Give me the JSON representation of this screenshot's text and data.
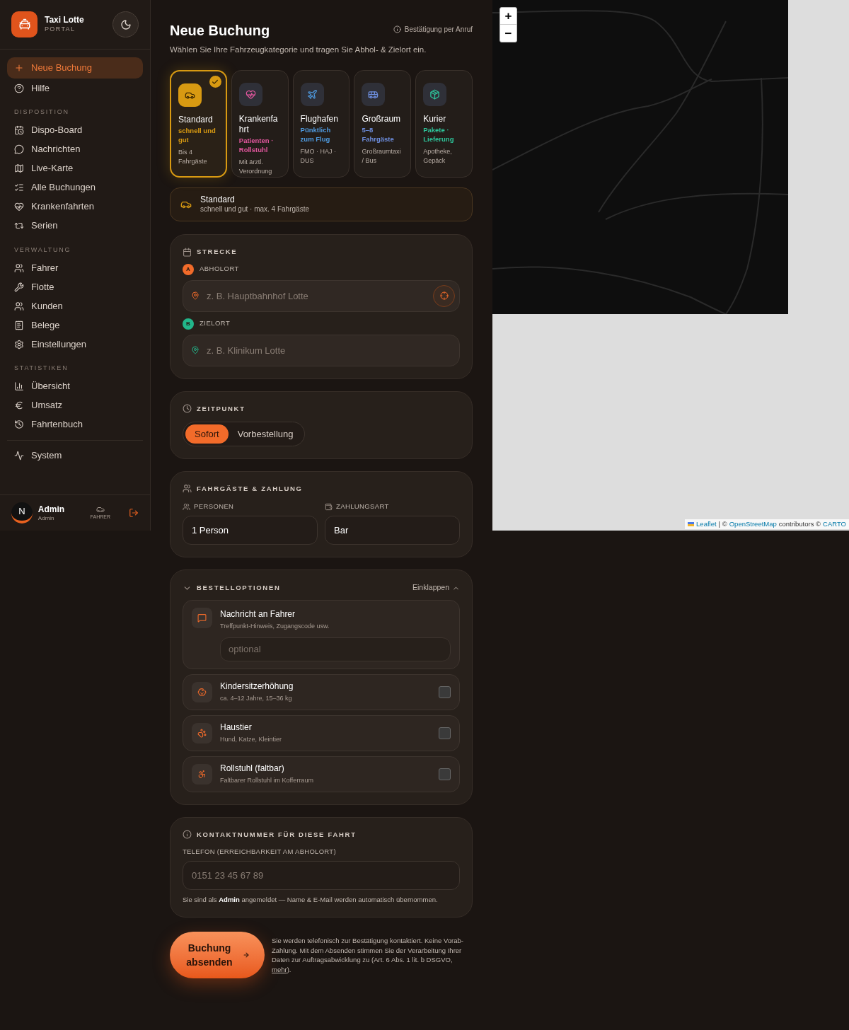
{
  "sidebar": {
    "brand": {
      "title": "Taxi Lotte",
      "subtitle": "PORTAL"
    },
    "top_items": [
      {
        "label": "Neue Buchung",
        "selected": true
      },
      {
        "label": "Hilfe",
        "selected": false
      }
    ],
    "sections": [
      {
        "title": "DISPOSITION",
        "items": [
          {
            "label": "Dispo-Board",
            "selected": false
          },
          {
            "label": "Nachrichten",
            "selected": false
          },
          {
            "label": "Live-Karte",
            "selected": false
          },
          {
            "label": "Alle Buchungen",
            "selected": false
          },
          {
            "label": "Krankenfahrten",
            "selected": false
          },
          {
            "label": "Serien",
            "selected": false
          }
        ]
      },
      {
        "title": "VERWALTUNG",
        "items": [
          {
            "label": "Fahrer",
            "selected": false
          },
          {
            "label": "Flotte",
            "selected": false
          },
          {
            "label": "Kunden",
            "selected": false
          },
          {
            "label": "Belege",
            "selected": false
          },
          {
            "label": "Einstellungen",
            "selected": false
          }
        ]
      },
      {
        "title": "STATISTIKEN",
        "items": [
          {
            "label": "Übersicht",
            "selected": false
          },
          {
            "label": "Umsatz",
            "selected": false
          },
          {
            "label": "Fahrtenbuch",
            "selected": false
          }
        ]
      }
    ],
    "bottom_items": [
      {
        "label": "System",
        "selected": false
      }
    ],
    "user": {
      "initial": "N",
      "name": "Admin",
      "role": "Admin",
      "switch_label": "FAHRER"
    }
  },
  "header": {
    "title": "Neue Buchung",
    "subtitle": "Wählen Sie Ihre Fahrzeugkategorie und tragen Sie Abhol- & Zielort ein.",
    "info": "Bestätigung per Anruf"
  },
  "vehicles": [
    {
      "title": "Standard",
      "tagline": "schnell und gut",
      "detail": "Bis 4 Fahrgäste",
      "color": "#d89a12",
      "selected": true
    },
    {
      "title": "Krankenfahrt",
      "tagline": "Patienten · Rollstuhl",
      "detail": "Mit ärztl. Verordnung",
      "color": "#e2579e",
      "selected": false
    },
    {
      "title": "Flughafen",
      "tagline": "Pünktlich zum Flug",
      "detail": "FMO · HAJ · DUS",
      "color": "#4f9be0",
      "selected": false
    },
    {
      "title": "Großraum",
      "tagline": "5–8 Fahrgäste",
      "detail": "Großraumtaxi / Bus",
      "color": "#6e8fe0",
      "selected": false
    },
    {
      "title": "Kurier",
      "tagline": "Pakete · Lieferung",
      "detail": "Apotheke, Gepäck",
      "color": "#2ec49a",
      "selected": false
    }
  ],
  "summary": {
    "title": "Standard",
    "text": "schnell und gut · max. 4 Fahrgäste"
  },
  "route": {
    "title": "STRECKE",
    "pickup": {
      "marker": "A",
      "label": "ABHOLORT",
      "placeholder": "z. B. Hauptbahnhof Lotte"
    },
    "destination": {
      "marker": "B",
      "label": "ZIELORT",
      "placeholder": "z. B. Klinikum Lotte"
    }
  },
  "time": {
    "title": "ZEITPUNKT",
    "options": [
      {
        "label": "Sofort",
        "selected": true
      },
      {
        "label": "Vorbestellung",
        "selected": false
      }
    ]
  },
  "passengers": {
    "title": "FAHRGÄSTE & ZAHLUNG",
    "persons": {
      "label": "PERSONEN",
      "value": "1 Person"
    },
    "payment": {
      "label": "ZAHLUNGSART",
      "value": "Bar"
    }
  },
  "options": {
    "title": "BESTELLOPTIONEN",
    "toggle": "Einklappen",
    "expanded": true,
    "message": {
      "title": "Nachricht an Fahrer",
      "hint": "Treffpunkt-Hinweis, Zugangscode usw.",
      "placeholder": "optional"
    },
    "extras": [
      {
        "title": "Kindersitzerhöhung",
        "hint": "ca. 4–12 Jahre, 15–36 kg",
        "checked": false
      },
      {
        "title": "Haustier",
        "hint": "Hund, Katze, Kleintier",
        "checked": false
      },
      {
        "title": "Rollstuhl (faltbar)",
        "hint": "Faltbarer Rollstuhl im Kofferraum",
        "checked": false
      }
    ]
  },
  "contact": {
    "title": "KONTAKTNUMMER FÜR DIESE FAHRT",
    "label": "TELEFON (ERREICHBARKEIT AM ABHOLORT)",
    "placeholder": "0151 23 45 67 89",
    "note": "Sie sind als **Admin** angemeldet — Name & E-Mail werden automatisch übernommen."
  },
  "submit": {
    "button": "Buchung absenden",
    "disclaimer": "Sie werden telefonisch zur Bestätigung kontaktiert. Keine Vorab-Zahlung. Mit dem Absenden stimmen Sie der Verarbeitung Ihrer Daten zur Auftragsabwicklung zu (Art. 6 Abs. 1 lit. b DSGVO, ",
    "link": "mehr",
    "disclaimer_end": ")."
  },
  "map": {
    "zoom_in": "+",
    "zoom_out": "−",
    "attribution": [
      {
        "text": "Leaflet",
        "link": true
      },
      {
        "text": "| ©",
        "link": false
      },
      {
        "text": "OpenStreetMap",
        "link": true
      },
      {
        "text": "contributors ©",
        "link": false
      },
      {
        "text": "CARTO",
        "link": true
      }
    ]
  }
}
